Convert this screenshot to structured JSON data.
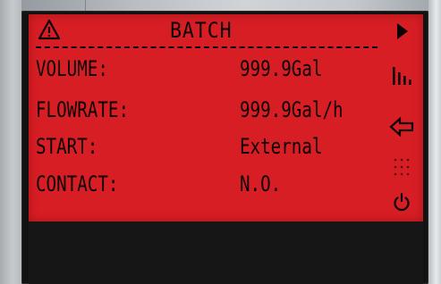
{
  "screen": {
    "title": "BATCH",
    "rows": [
      {
        "label": "VOLUME:",
        "value": "999.9Gal"
      },
      {
        "label": "FLOWRATE:",
        "value": "999.9Gal/h"
      },
      {
        "label": "START:",
        "value": "External"
      },
      {
        "label": "CONTACT:",
        "value": "N.O."
      }
    ]
  },
  "icons": {
    "title": "warning-triangle",
    "side": [
      "play-right",
      "bar-graph",
      "back-arrow",
      "dot-grid",
      "power"
    ]
  },
  "colors": {
    "lcd_background": "#d81e25",
    "lcd_text": "#0c0404",
    "bezel": "#121212"
  }
}
